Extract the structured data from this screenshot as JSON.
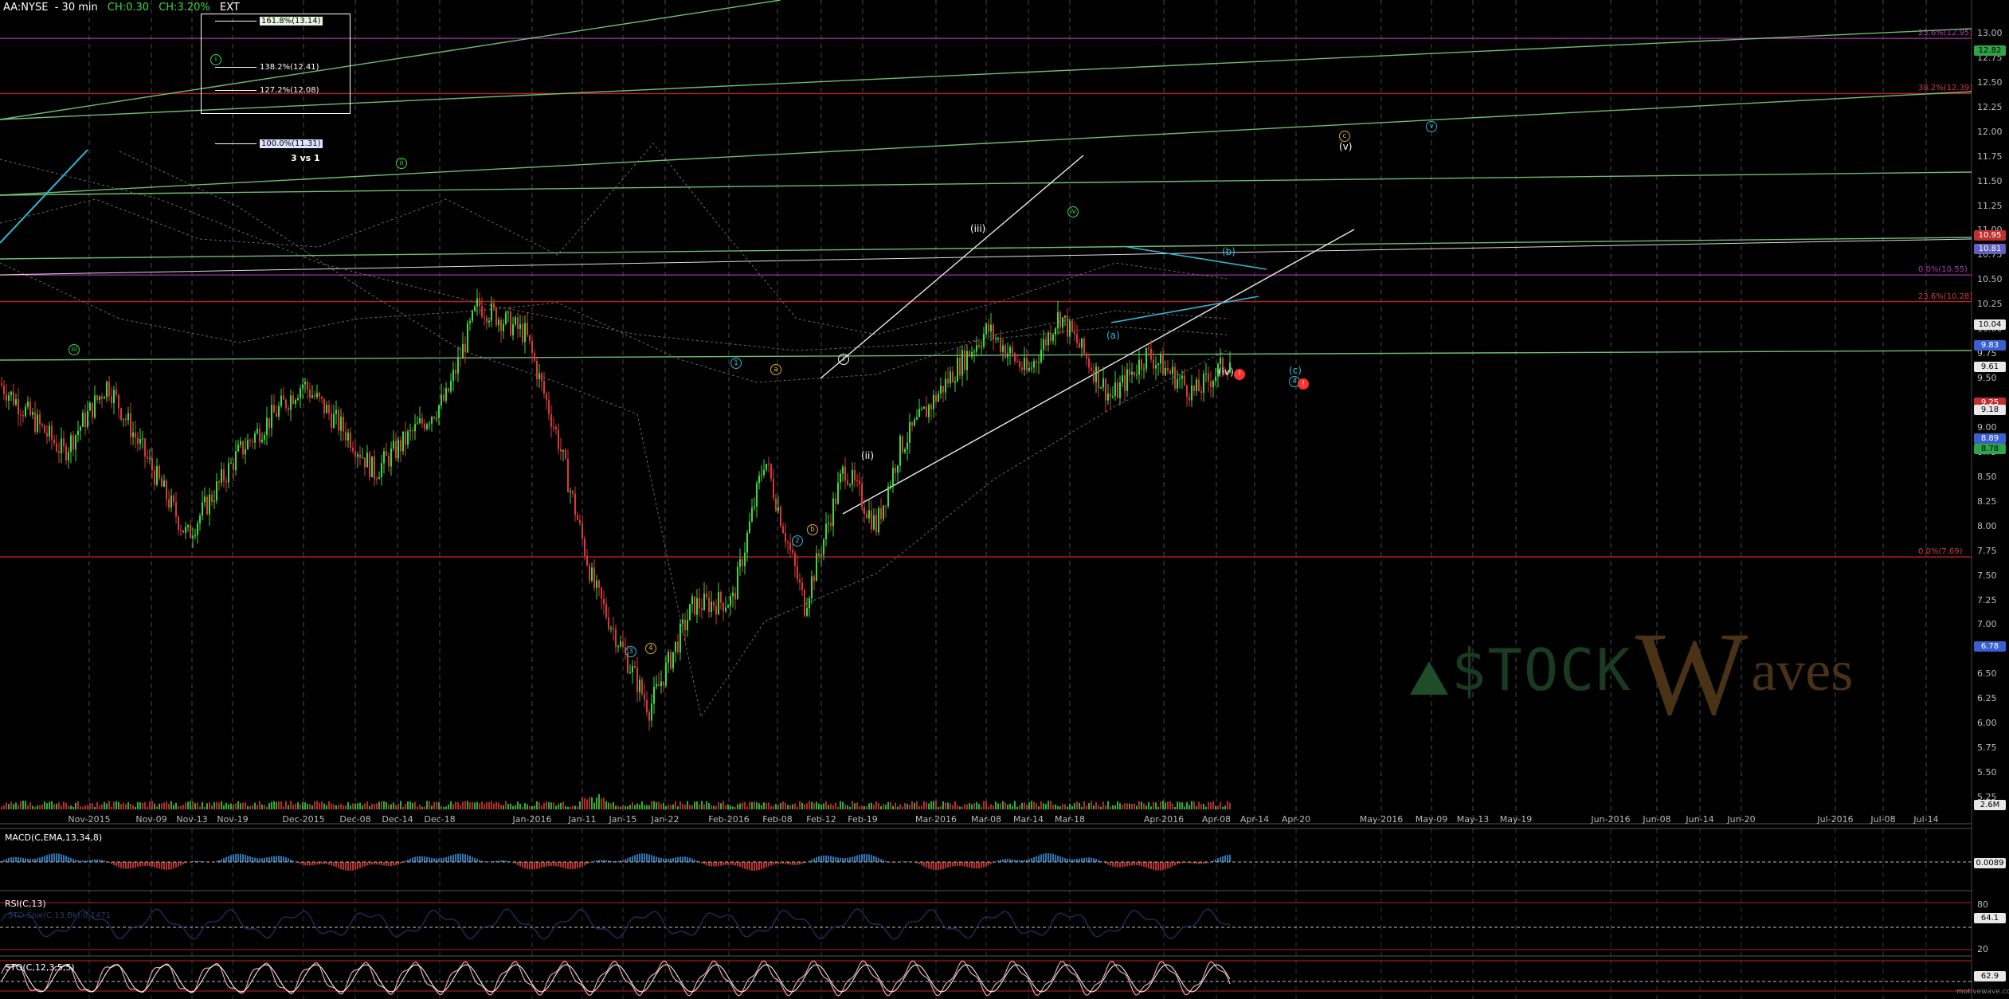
{
  "header": {
    "symbol": "AA:NYSE",
    "interval": "30 min",
    "change": "CH:0.30",
    "change_pct": "CH:3.20%",
    "session": "EXT"
  },
  "price_axis": {
    "labels": [
      "13.00",
      "12.75",
      "12.50",
      "12.25",
      "12.00",
      "11.75",
      "11.50",
      "11.25",
      "11.00",
      "10.75",
      "10.50",
      "10.25",
      "10.00",
      "9.75",
      "9.50",
      "9.25",
      "9.00",
      "8.75",
      "8.50",
      "8.25",
      "8.00",
      "7.75",
      "7.50",
      "7.25",
      "7.00",
      "6.75",
      "6.50",
      "6.25",
      "6.00",
      "5.75",
      "5.50",
      "5.25"
    ]
  },
  "price_boxes": [
    {
      "text": "12.82",
      "bg": "#2fa24a",
      "fg": "#000000"
    },
    {
      "text": "10.95",
      "bg": "#c03030",
      "fg": "#ffffff"
    },
    {
      "text": "10.81",
      "bg": "#6060c0",
      "fg": "#ffffff"
    },
    {
      "text": "10.04",
      "bg": "#e8e8e8",
      "fg": "#000000"
    },
    {
      "text": "9.83",
      "bg": "#3a60d0",
      "fg": "#ffffff"
    },
    {
      "text": "9.61",
      "bg": "#e8e8e8",
      "fg": "#000000"
    },
    {
      "text": "9.25",
      "bg": "#c03030",
      "fg": "#ffffff"
    },
    {
      "text": "9.18",
      "bg": "#e8e8e8",
      "fg": "#000000"
    },
    {
      "text": "8.89",
      "bg": "#3a60d0",
      "fg": "#ffffff"
    },
    {
      "text": "8.78",
      "bg": "#2fa24a",
      "fg": "#000000"
    },
    {
      "text": "6.78",
      "bg": "#3a60d0",
      "fg": "#ffffff"
    },
    {
      "text": "2.6M",
      "bg": "#e8e8e8",
      "fg": "#000000"
    }
  ],
  "date_axis": {
    "labels": [
      "Nov-2015",
      "Nov-09",
      "Nov-13",
      "Nov-19",
      "Dec-2015",
      "Dec-08",
      "Dec-14",
      "Dec-18",
      "Jan-2016",
      "Jan-11",
      "Jan-15",
      "Jan-22",
      "Feb-2016",
      "Feb-08",
      "Feb-12",
      "Feb-19",
      "Mar-2016",
      "Mar-08",
      "Mar-14",
      "Mar-18",
      "Apr-2016",
      "Apr-08",
      "Apr-14",
      "Apr-20",
      "May-2016",
      "May-09",
      "May-13",
      "May-19",
      "Jun-2016",
      "Jun-08",
      "Jun-14",
      "Jun-20",
      "Jul-2016",
      "Jul-08",
      "Jul-14"
    ]
  },
  "fib_box": {
    "items": [
      "161.8%(13.14)",
      "138.2%(12.41)",
      "127.2%(12.08)"
    ],
    "extra": "100.0%(11.31)",
    "note": "3 vs 1"
  },
  "fib_levels": [
    {
      "text": "23.6%(12.95)",
      "kind": "p"
    },
    {
      "text": "38.2%(12.39)",
      "kind": "r"
    },
    {
      "text": "0.0%(10.55)",
      "kind": "p"
    },
    {
      "text": "23.6%(10.28)",
      "kind": "r"
    },
    {
      "text": "0.0%(7.69)",
      "kind": "r"
    }
  ],
  "wave_labels": [
    {
      "text": "(iii)",
      "color": "#ffffff"
    },
    {
      "text": "(ii)",
      "color": "#ffffff"
    },
    {
      "text": "(iv)",
      "color": "#ffffff"
    },
    {
      "text": "(v)",
      "color": "#ffffff"
    },
    {
      "text": "(a)",
      "color": "#2fb8d8"
    },
    {
      "text": "(b)",
      "color": "#2fb8d8"
    },
    {
      "text": "(c)",
      "color": "#2fb8d8"
    }
  ],
  "circle_labels": [
    {
      "text": "i",
      "color": "#3ddc3d"
    },
    {
      "text": "ii",
      "color": "#3ddc3d"
    },
    {
      "text": "iii",
      "color": "#3ddc3d"
    },
    {
      "text": "iv",
      "color": "#3ddc3d"
    },
    {
      "text": "v",
      "color": "#2fb8d8"
    },
    {
      "text": "1",
      "color": "#2fb8d8"
    },
    {
      "text": "2",
      "color": "#2fb8d8"
    },
    {
      "text": "3",
      "color": "#2fb8d8"
    },
    {
      "text": "4",
      "color": "#2fb8d8"
    },
    {
      "text": "a",
      "color": "#e0b020"
    },
    {
      "text": "b",
      "color": "#e0b020"
    },
    {
      "text": "c",
      "color": "#e0b020"
    },
    {
      "text": "4",
      "color": "#e0b020"
    },
    {
      "text": "i",
      "color": "#ffffff"
    },
    {
      "text": "!",
      "color": "#ff3030"
    },
    {
      "text": "!",
      "color": "#ff3030"
    }
  ],
  "panels": {
    "macd": {
      "title": "MACD(C,EMA,13,34,8)",
      "value": "0.0089"
    },
    "rsi": {
      "title": "RSI(C,13)",
      "subtitle": "STO Sow(C,13,Bk):0.1471",
      "value": "64.1",
      "levels": [
        "80",
        "20"
      ]
    },
    "sto": {
      "title": "STO(C,12,3,5,5)",
      "value": "62.9"
    }
  },
  "watermark": {
    "text": "$TOCK",
    "suffix": "aves",
    "big": "W"
  },
  "footer": {
    "text": "motivewave.com"
  },
  "colors": {
    "bg": "#000000",
    "up": "#3ddc3d",
    "down": "#d83a3a",
    "grid": "#777777",
    "fib_red": "#c02020",
    "fib_purple": "#9a2a9a",
    "trend": "#7ed37e",
    "cyan": "#2fb8d8"
  }
}
